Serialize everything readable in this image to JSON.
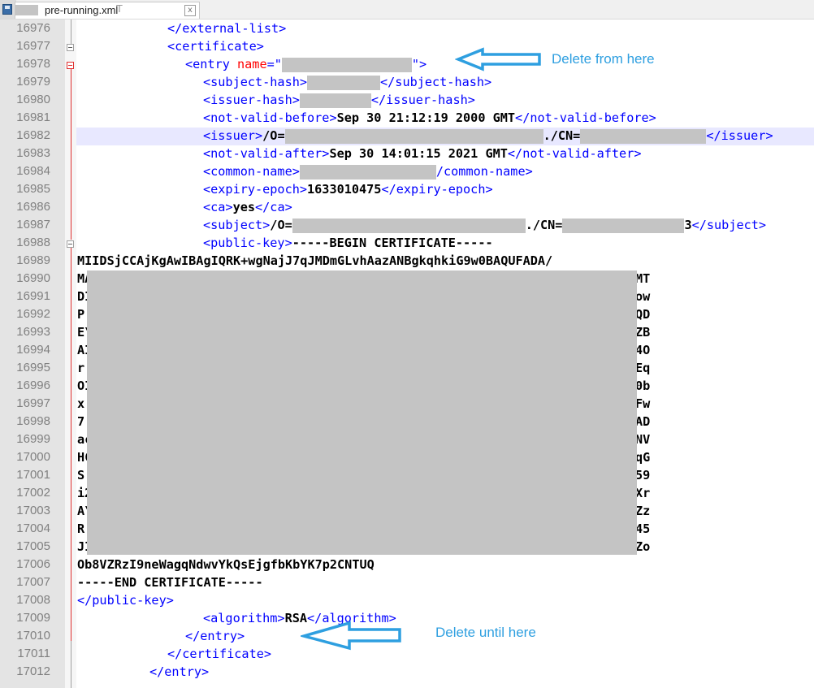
{
  "tab": {
    "title": "pre-running.xml",
    "partial": "T",
    "close_glyph": "x"
  },
  "lines": [
    {
      "n": "16976"
    },
    {
      "n": "16977"
    },
    {
      "n": "16978"
    },
    {
      "n": "16979"
    },
    {
      "n": "16980"
    },
    {
      "n": "16981"
    },
    {
      "n": "16982"
    },
    {
      "n": "16983"
    },
    {
      "n": "16984"
    },
    {
      "n": "16985"
    },
    {
      "n": "16986"
    },
    {
      "n": "16987"
    },
    {
      "n": "16988"
    },
    {
      "n": "16989"
    },
    {
      "n": "16990"
    },
    {
      "n": "16991"
    },
    {
      "n": "16992"
    },
    {
      "n": "16993"
    },
    {
      "n": "16994"
    },
    {
      "n": "16995"
    },
    {
      "n": "16996"
    },
    {
      "n": "16997"
    },
    {
      "n": "16998"
    },
    {
      "n": "16999"
    },
    {
      "n": "17000"
    },
    {
      "n": "17001"
    },
    {
      "n": "17002"
    },
    {
      "n": "17003"
    },
    {
      "n": "17004"
    },
    {
      "n": "17005"
    },
    {
      "n": "17006"
    },
    {
      "n": "17007"
    },
    {
      "n": "17008"
    },
    {
      "n": "17009"
    },
    {
      "n": "17010"
    },
    {
      "n": "17011"
    },
    {
      "n": "17012"
    }
  ],
  "code": {
    "l16976": "</external-list>",
    "l16977": "<certificate>",
    "l16978_open": "<entry ",
    "l16978_attr": "name",
    "l16978_eq": "=\"",
    "l16978_end": "\">",
    "l16979_open": "<subject-hash>",
    "l16979_close": "</subject-hash>",
    "l16980_open": "<issuer-hash>",
    "l16980_close": "</issuer-hash>",
    "l16981_open": "<not-valid-before>",
    "l16981_val": "Sep 30 21:12:19 2000 GMT",
    "l16981_close": "</not-valid-before>",
    "l16982_open": "<issuer>",
    "l16982_val1": "/O=",
    "l16982_val2": "./CN=",
    "l16982_close": "</issuer>",
    "l16983_open": "<not-valid-after>",
    "l16983_val": "Sep 30 14:01:15 2021 GMT",
    "l16983_close": "</not-valid-after>",
    "l16984_open": "<common-name>",
    "l16984_close": "/common-name>",
    "l16985_open": "<expiry-epoch>",
    "l16985_val": "1633010475",
    "l16985_close": "</expiry-epoch>",
    "l16986_open": "<ca>",
    "l16986_val": "yes",
    "l16986_close": "</ca>",
    "l16987_open": "<subject>",
    "l16987_val1": "/O=",
    "l16987_val2": "./CN=",
    "l16987_tail": "3",
    "l16987_close": "</subject>",
    "l16988_open": "<public-key>",
    "l16988_val": "-----BEGIN CERTIFICATE-----",
    "l16989": "MIIDSjCCAjKgAwIBAgIQRK+wgNajJ7qJMDmGLvhAazANBgkqhkiG9w0BAQUFADA/",
    "left_chars": [
      "MA",
      "DI",
      "P:",
      "E\\",
      "AI",
      "r:",
      "OI",
      "x.",
      "7:",
      "ac",
      "HC",
      "S:",
      "i2",
      "A\\",
      "R:",
      "JI"
    ],
    "right_chars": [
      "MT",
      "ow",
      "QD",
      "ZB",
      "4O",
      "Eq",
      "0b",
      "Fw",
      "AD",
      "NV",
      "qG",
      "59",
      "Xr",
      "Zz",
      "45",
      "Zo"
    ],
    "l17006": "Ob8VZRzI9neWagqNdwvYkQsEjgfbKbYK7p2CNTUQ",
    "l17007": "-----END CERTIFICATE-----",
    "l17008": "</public-key>",
    "l17009_open": "<algorithm>",
    "l17009_val": "RSA",
    "l17009_close": "</algorithm>",
    "l17010": "</entry>",
    "l17011": "</certificate>",
    "l17012": "</entry>"
  },
  "annotations": {
    "from": "Delete from here",
    "until": "Delete until here",
    "color": "#2e9fe0"
  }
}
